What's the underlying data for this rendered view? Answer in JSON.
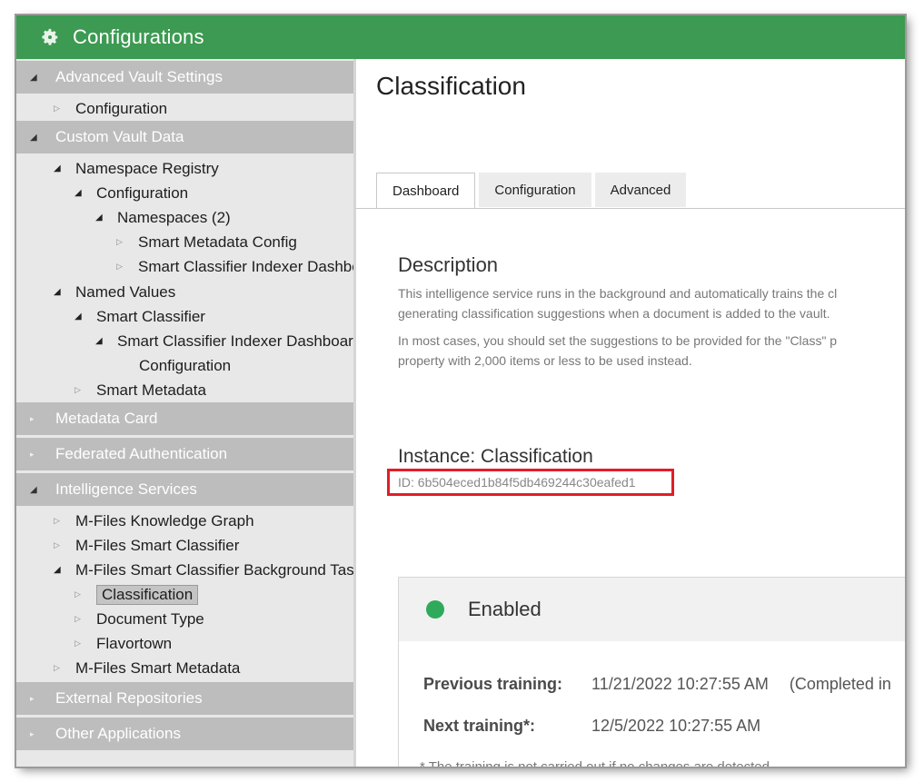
{
  "window": {
    "title": "Configurations",
    "icon": "gear-icon"
  },
  "sidebar": {
    "sections": [
      {
        "label": "Advanced Vault Settings",
        "expanded": true
      },
      {
        "label": "Custom Vault Data",
        "expanded": true
      },
      {
        "label": "Metadata Card",
        "expanded": false
      },
      {
        "label": "Federated Authentication",
        "expanded": false
      },
      {
        "label": "Intelligence Services",
        "expanded": true
      },
      {
        "label": "External Repositories",
        "expanded": false
      },
      {
        "label": "Other Applications",
        "expanded": false
      }
    ],
    "items": [
      {
        "label": "Configuration",
        "expanded": false
      },
      {
        "label": "Namespace Registry",
        "expanded": true
      },
      {
        "label": "Configuration",
        "expanded": true
      },
      {
        "label": "Namespaces (2)",
        "expanded": true
      },
      {
        "label": "Smart Metadata Config",
        "expanded": false
      },
      {
        "label": "Smart Classifier Indexer Dashbo",
        "expanded": false
      },
      {
        "label": "Named Values",
        "expanded": true
      },
      {
        "label": "Smart Classifier",
        "expanded": true
      },
      {
        "label": "Smart Classifier Indexer Dashboar",
        "expanded": true
      },
      {
        "label": "Configuration",
        "expanded": null
      },
      {
        "label": "Smart Metadata",
        "expanded": false
      },
      {
        "label": "M-Files Knowledge Graph",
        "expanded": false
      },
      {
        "label": "M-Files Smart Classifier",
        "expanded": false
      },
      {
        "label": "M-Files Smart Classifier Background Tas",
        "expanded": true
      },
      {
        "label": "Classification",
        "expanded": false,
        "selected": true
      },
      {
        "label": "Document Type",
        "expanded": false
      },
      {
        "label": "Flavortown",
        "expanded": false
      },
      {
        "label": "M-Files Smart Metadata",
        "expanded": false
      }
    ]
  },
  "main": {
    "title": "Classification",
    "tabs": [
      {
        "label": "Dashboard",
        "active": true
      },
      {
        "label": "Configuration",
        "active": false
      },
      {
        "label": "Advanced",
        "active": false
      }
    ],
    "description": {
      "heading": "Description",
      "lines": [
        "This intelligence service runs in the background and automatically trains the cl",
        "generating classification suggestions when a document is added to the vault.",
        "In most cases, you should set the suggestions to be provided for the \"Class\" p",
        "property with 2,000 items or less to be used instead."
      ]
    },
    "instance": {
      "heading": "Instance: Classification",
      "id": "ID: 6b504eced1b84f5db469244c30eafed1"
    },
    "status": {
      "label": "Enabled",
      "color": "#2eaa5a",
      "previous_label": "Previous training:",
      "previous_value": "11/21/2022 10:27:55 AM",
      "previous_extra": "(Completed in",
      "next_label": "Next training*:",
      "next_value": "12/5/2022 10:27:55 AM",
      "note": "* The training is not carried out if no changes are detected."
    }
  },
  "colors": {
    "titlebar": "#3c9a52",
    "section": "#bdbdbd",
    "highlight_box": "#e01e28"
  }
}
